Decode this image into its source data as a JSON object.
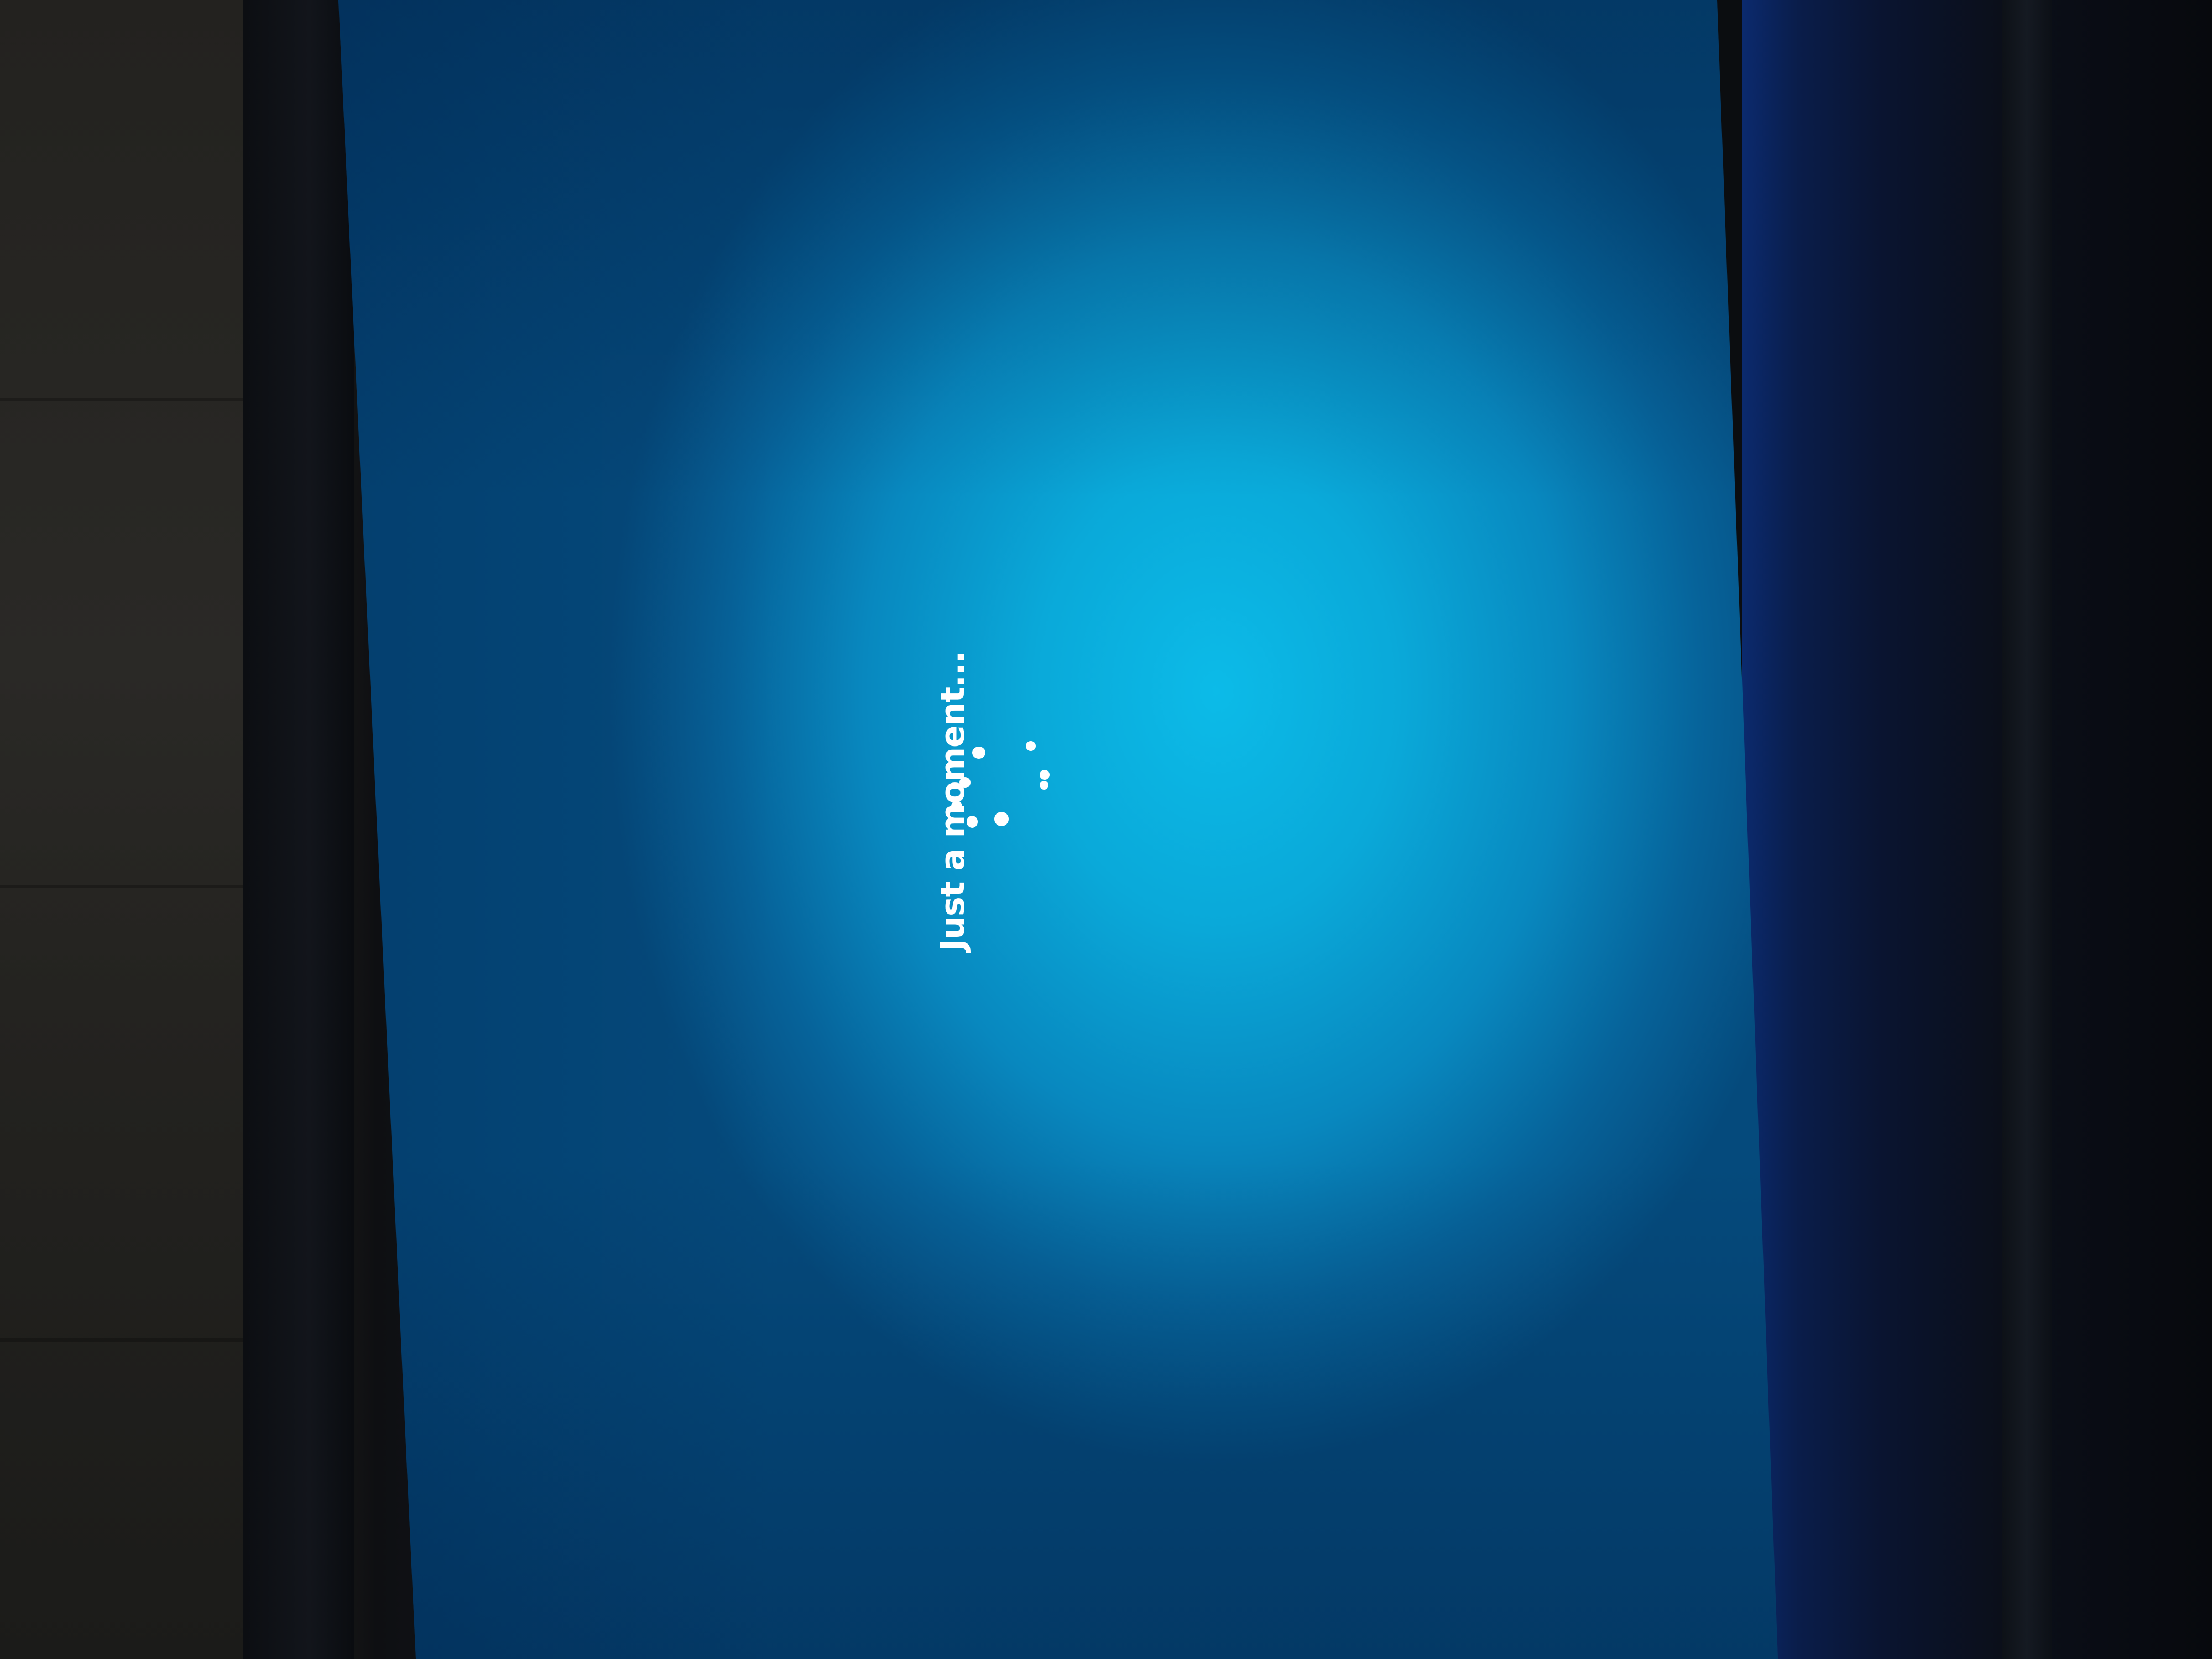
{
  "screen": {
    "message": "Just a moment...",
    "background_color": "#0aa9d9",
    "text_color": "#ffffff"
  },
  "spinner": {
    "icon": "loading-spinner-icon",
    "dot_count": 7
  }
}
